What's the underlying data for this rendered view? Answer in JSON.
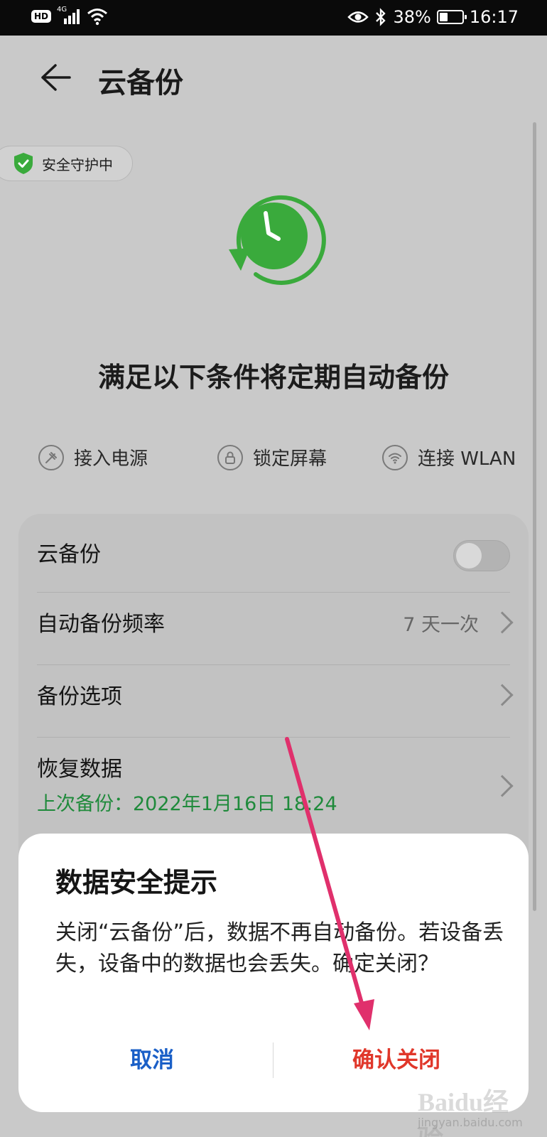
{
  "status_bar": {
    "hd": "HD",
    "network": "4G",
    "battery_percent": "38%",
    "battery_level": 0.38,
    "time": "16:17"
  },
  "header": {
    "title": "云备份"
  },
  "security_chip": {
    "label": "安全守护中"
  },
  "conditions": {
    "title": "满足以下条件将定期自动备份",
    "items": [
      {
        "label": "接入电源",
        "icon": "power-plug-icon"
      },
      {
        "label": "锁定屏幕",
        "icon": "lock-icon"
      },
      {
        "label": "连接 WLAN",
        "icon": "wifi-icon"
      }
    ]
  },
  "settings": {
    "cloud_backup": {
      "label": "云备份",
      "enabled": false
    },
    "frequency": {
      "label": "自动备份频率",
      "value": "7 天一次"
    },
    "options": {
      "label": "备份选项"
    },
    "restore": {
      "label": "恢复数据",
      "last_backup": "上次备份：2022年1月16日 18:24"
    }
  },
  "dialog": {
    "title": "数据安全提示",
    "body": "关闭“云备份”后，数据不再自动备份。若设备丢失，设备中的数据也会丢失。确定关闭？",
    "cancel_label": "取消",
    "confirm_label": "确认关闭"
  },
  "watermark": {
    "brand": "Baidu经验",
    "url": "jingyan.baidu.com"
  },
  "colors": {
    "accent_green": "#3aaa3c",
    "cancel_blue": "#1a5fc7",
    "confirm_red": "#e0372a",
    "annotation_arrow": "#e0306c"
  }
}
